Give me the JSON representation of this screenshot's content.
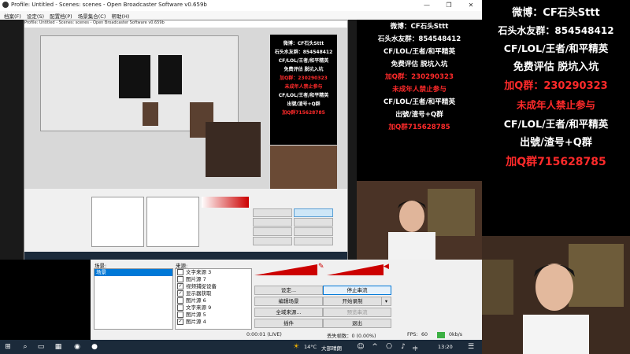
{
  "window": {
    "title": "Profile: Untitled - Scenes: scenes - Open Broadcaster Software v0.659b",
    "minimize_label": "—",
    "maximize_label": "❐",
    "close_label": "✕"
  },
  "menu": [
    "档案(F)",
    "设定(S)",
    "配置档(P)",
    "场景集合(C)",
    "帮助(H)"
  ],
  "nested_title": "Profile: Untitled - Scenes: scenes - Open Broadcaster Software v0.659b",
  "overlay": {
    "lines": [
      {
        "text": "微博：CF石头Sttt",
        "color": "#ffffff"
      },
      {
        "text": "石头水友群：854548412",
        "color": "#ffffff"
      },
      {
        "text": "CF/LOL/王者/和平精英",
        "color": "#ffffff"
      },
      {
        "text": "免费评估 脱坑入坑",
        "color": "#ffffff"
      },
      {
        "text": "加Q群：230290323",
        "color": "#ff2a2a"
      },
      {
        "text": "未成年人禁止参与",
        "color": "#ff2a2a"
      },
      {
        "text": "CF/LOL/王者/和平精英",
        "color": "#ffffff"
      },
      {
        "text": "出號/渣号+Q群",
        "color": "#ffffff"
      },
      {
        "text": "加Q群715628785",
        "color": "#ff2a2a"
      }
    ]
  },
  "dock": {
    "scenes_label": "场景:",
    "sources_label": "来源:",
    "scenes": [
      "场景"
    ],
    "sources": [
      {
        "label": "文字来源 3",
        "checked": false
      },
      {
        "label": "图片源 7",
        "checked": false
      },
      {
        "label": "视频捕捉设备",
        "checked": true
      },
      {
        "label": "显示器获取",
        "checked": true
      },
      {
        "label": "图片源 6",
        "checked": false
      },
      {
        "label": "文字来源 9",
        "checked": false
      },
      {
        "label": "图片源 5",
        "checked": false
      },
      {
        "label": "图片源 4",
        "checked": true
      }
    ],
    "buttons": {
      "settings": "设定...",
      "stop_stream": "停止串流",
      "edit_scene": "编辑场景",
      "start_record": "开始录制",
      "global_sources": "全域来源...",
      "preview_stream": "预览串流",
      "plugins": "插件",
      "exit": "退出"
    }
  },
  "status": {
    "time": "0:00:01 (LIVE)",
    "dropped": "丢失帧数：0 (0.00%)",
    "fps_label": "FPS:",
    "fps": "60",
    "bitrate": "0kb/s"
  },
  "taskbar": {
    "weather_temp": "14°C",
    "weather_text": "大部晴朗",
    "clock": "13:20",
    "ime": "中"
  },
  "colors": {
    "overlay_red": "#ff2a2a",
    "meter_red": "#cc0000",
    "taskbar_bg": "#1b2a3a",
    "scene_selected": "#0078d7"
  }
}
